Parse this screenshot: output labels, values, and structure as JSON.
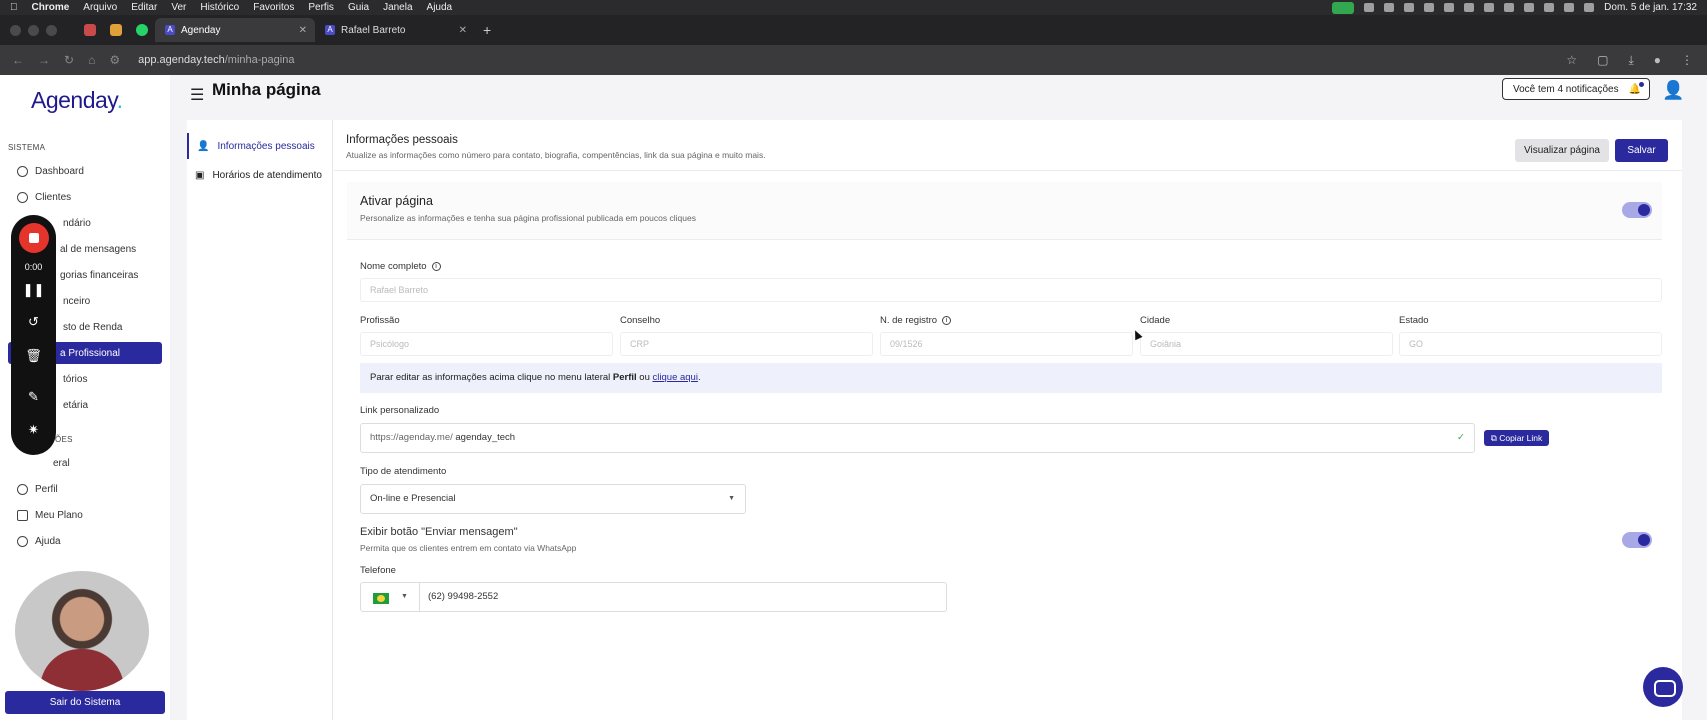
{
  "menubar": {
    "app": "Chrome",
    "items": [
      "Arquivo",
      "Editar",
      "Ver",
      "Histórico",
      "Favoritos",
      "Perfis",
      "Guia",
      "Janela",
      "Ajuda"
    ],
    "clock": "Dom. 5 de jan.  17:32"
  },
  "tabs": [
    {
      "title": "Agenday"
    },
    {
      "title": "Rafael Barreto"
    }
  ],
  "address": {
    "domain": "app.agenday.tech",
    "path": "/minha-pagina"
  },
  "sidebar": {
    "logo": "Agenday",
    "section_system": "SISTEMA",
    "items": [
      "Dashboard",
      "Clientes",
      "ndário",
      "al de mensagens",
      "gorias financeiras",
      "nceiro",
      "sto de Renda",
      "a Profissional",
      "tórios",
      "etária"
    ],
    "section_config": "ÕES",
    "config_items": [
      "eral",
      "Perfil",
      "Meu Plano",
      "Ajuda"
    ],
    "logout": "Sair do Sistema"
  },
  "recorder": {
    "time": "0:00"
  },
  "header": {
    "title": "Minha página",
    "notifications": "Você tem 4 notificações"
  },
  "subnav": [
    "Informações pessoais",
    "Horários de atendimento"
  ],
  "section": {
    "title": "Informações pessoais",
    "subtitle": "Atualize as informações como número para contato, biografia, compentências, link da sua página e muito mais.",
    "view_button": "Visualizar página",
    "save_button": "Salvar"
  },
  "activate": {
    "title": "Ativar página",
    "subtitle": "Personalize as informações e tenha sua página profissional publicada em poucos cliques",
    "enabled": true
  },
  "form": {
    "name_label": "Nome completo",
    "name_value": "Rafael Barreto",
    "profession_label": "Profissão",
    "profession_value": "Psicólogo",
    "council_label": "Conselho",
    "council_value": "CRP",
    "registry_label": "N. de registro",
    "registry_value": "09/1526",
    "city_label": "Cidade",
    "city_value": "Goiânia",
    "state_label": "Estado",
    "state_value": "GO",
    "notice_prefix": "Parar editar as informações acima clique no menu lateral ",
    "notice_bold": "Perfil",
    "notice_mid": " ou ",
    "notice_link": "clique aqui",
    "notice_end": ".",
    "link_label": "Link personalizado",
    "link_prefix": "https://agenday.me/",
    "link_value": "agenday_tech",
    "copy_button": "Copiar Link",
    "service_label": "Tipo de atendimento",
    "service_value": "On-line e Presencial",
    "message_title": "Exibir botão \"Enviar mensagem\"",
    "message_subtitle": "Permita que os clientes entrem em contato via WhatsApp",
    "message_enabled": true,
    "phone_label": "Telefone",
    "phone_value": "(62) 99498-2552"
  }
}
